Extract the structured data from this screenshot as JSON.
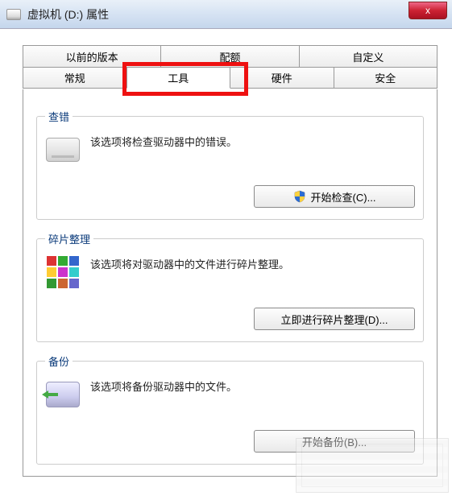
{
  "window": {
    "title": "虚拟机 (D:) 属性",
    "close_label": "x"
  },
  "tabs": {
    "row1": [
      "以前的版本",
      "配额",
      "自定义"
    ],
    "row2": [
      "常规",
      "工具",
      "硬件",
      "安全"
    ],
    "active": "工具"
  },
  "groups": {
    "check": {
      "legend": "查错",
      "text": "该选项将检查驱动器中的错误。",
      "button": "开始检查(C)..."
    },
    "defrag": {
      "legend": "碎片整理",
      "text": "该选项将对驱动器中的文件进行碎片整理。",
      "button": "立即进行碎片整理(D)..."
    },
    "backup": {
      "legend": "备份",
      "text": "该选项将备份驱动器中的文件。",
      "button": "开始备份(B)..."
    }
  }
}
